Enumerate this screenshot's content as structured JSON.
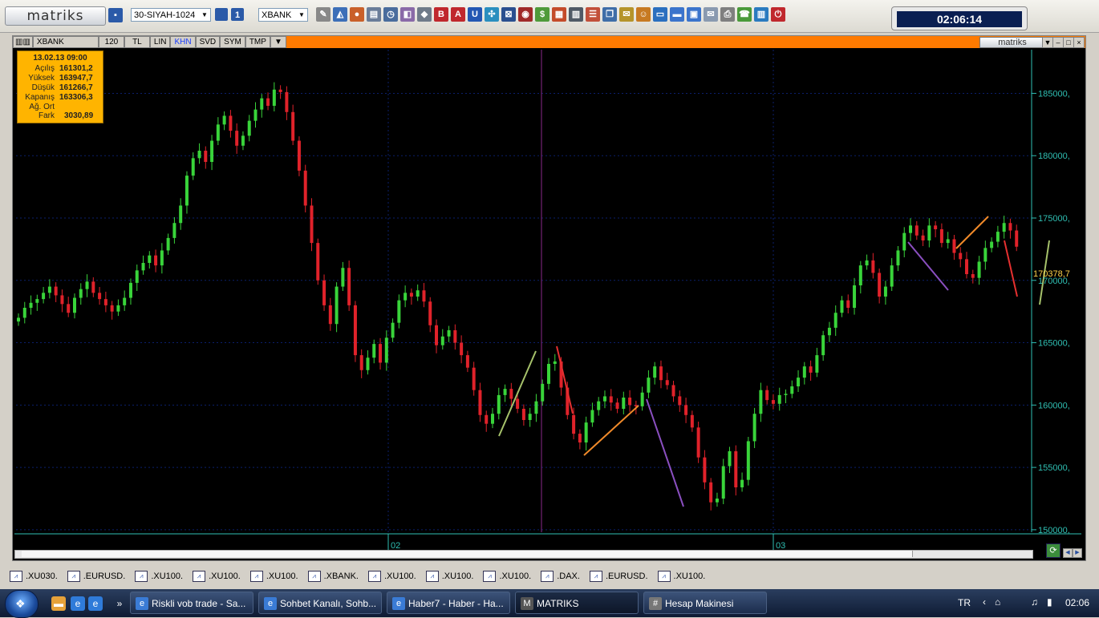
{
  "toolbar": {
    "logo": "matriks",
    "layout_combo": "30-SIYAH-1024",
    "symbol_combo": "XBANK",
    "icons": [
      "crosshair-icon",
      "chart-icon",
      "globe-icon",
      "table-icon",
      "clock-icon",
      "news-icon",
      "portfolio-icon",
      "bold-icon",
      "A-icon",
      "U-icon",
      "grid-icon",
      "network-icon",
      "eye-icon",
      "money-icon",
      "news2-icon",
      "print-icon",
      "phone-icon",
      "books-icon"
    ],
    "clock": "02:06:14"
  },
  "chart_header": {
    "symbol": "XBANK",
    "tabs": [
      "120",
      "TL",
      "LIN",
      "KHN",
      "SVD",
      "SYM",
      "TMP"
    ],
    "active_tab": "KHN",
    "brand": "matriks"
  },
  "info_box": {
    "date": "13.02.13 09:00",
    "rows": [
      {
        "label": "Açılış",
        "value": "161301,2"
      },
      {
        "label": "Yüksek",
        "value": "163947,7"
      },
      {
        "label": "Düşük",
        "value": "161266,7"
      },
      {
        "label": "Kapanış",
        "value": "163306,3"
      },
      {
        "label": "Ağ. Ort",
        "value": ""
      },
      {
        "label": "Fark",
        "value": "3030,89"
      }
    ]
  },
  "chart_data": {
    "type": "candlestick",
    "symbol": "XBANK",
    "y_ticks": [
      "185000,",
      "180000,",
      "175000,",
      "170000,",
      "165000,",
      "160000,",
      "155000,",
      "150000,"
    ],
    "ylim": [
      149800,
      188500
    ],
    "x_ticks": [
      "02",
      "03"
    ],
    "last_price": "170378,7",
    "closes": [
      167000,
      167800,
      168200,
      168500,
      169000,
      169500,
      168800,
      168100,
      167400,
      168600,
      169300,
      169900,
      169000,
      168500,
      168000,
      167500,
      168000,
      168600,
      169800,
      170800,
      171400,
      172000,
      171200,
      172400,
      173400,
      174600,
      176000,
      178400,
      179800,
      180400,
      179500,
      181200,
      182500,
      183200,
      182000,
      180800,
      181600,
      182800,
      183700,
      184600,
      184000,
      185300,
      185100,
      183500,
      181200,
      178800,
      176000,
      173000,
      170000,
      168000,
      166500,
      169500,
      171000,
      168000,
      164000,
      162800,
      163800,
      164900,
      163400,
      165400,
      166600,
      168400,
      169000,
      168700,
      169200,
      168300,
      166400,
      164800,
      165500,
      166000,
      165000,
      164000,
      163000,
      161200,
      159200,
      158500,
      159300,
      160800,
      161300,
      160500,
      159700,
      158800,
      159300,
      160300,
      161700,
      163300,
      163500,
      161400,
      159200,
      157700,
      157000,
      158600,
      159600,
      160300,
      160700,
      160200,
      159700,
      160600,
      160000,
      159900,
      161000,
      162200,
      163100,
      162000,
      161600,
      160700,
      160000,
      159200,
      158200,
      155800,
      153800,
      152200,
      152500,
      155100,
      156300,
      153400,
      154000,
      157100,
      159300,
      161200,
      160400,
      160100,
      160800,
      160900,
      161500,
      162200,
      163100,
      162600,
      164000,
      165600,
      166200,
      167400,
      168400,
      167800,
      169600,
      171200,
      171600,
      170600,
      168700,
      169500,
      171200,
      172400,
      173800,
      174400,
      173600,
      173200,
      174400,
      174100,
      173000,
      173300,
      172200,
      171700,
      170500,
      170200,
      171500,
      172600,
      173100,
      173900,
      174600,
      174000,
      172700
    ],
    "annotation_lines": [
      {
        "color": "#a6c26b",
        "from": [
          158000,
          "02"
        ],
        "to": [
          164000,
          "02"
        ]
      }
    ]
  },
  "symbols_bar": [
    ".XU030.",
    ".EURUSD.",
    ".XU100.",
    ".XU100.",
    ".XU100.",
    ".XBANK.",
    ".XU100.",
    ".XU100.",
    ".XU100.",
    ".DAX.",
    ".EURUSD.",
    ".XU100."
  ],
  "taskbar": {
    "tasks": [
      {
        "label": "Riskli vob trade - Sa...",
        "icon": "e",
        "color": "#3a7bd5"
      },
      {
        "label": "Sohbet Kanalı, Sohb...",
        "icon": "e",
        "color": "#3a7bd5"
      },
      {
        "label": "Haber7 - Haber - Ha...",
        "icon": "e",
        "color": "#3a7bd5"
      },
      {
        "label": "MATRIKS",
        "icon": "M",
        "color": "#555"
      },
      {
        "label": "Hesap Makinesi",
        "icon": "#",
        "color": "#777"
      }
    ],
    "lang": "TR",
    "time": "02:06"
  }
}
